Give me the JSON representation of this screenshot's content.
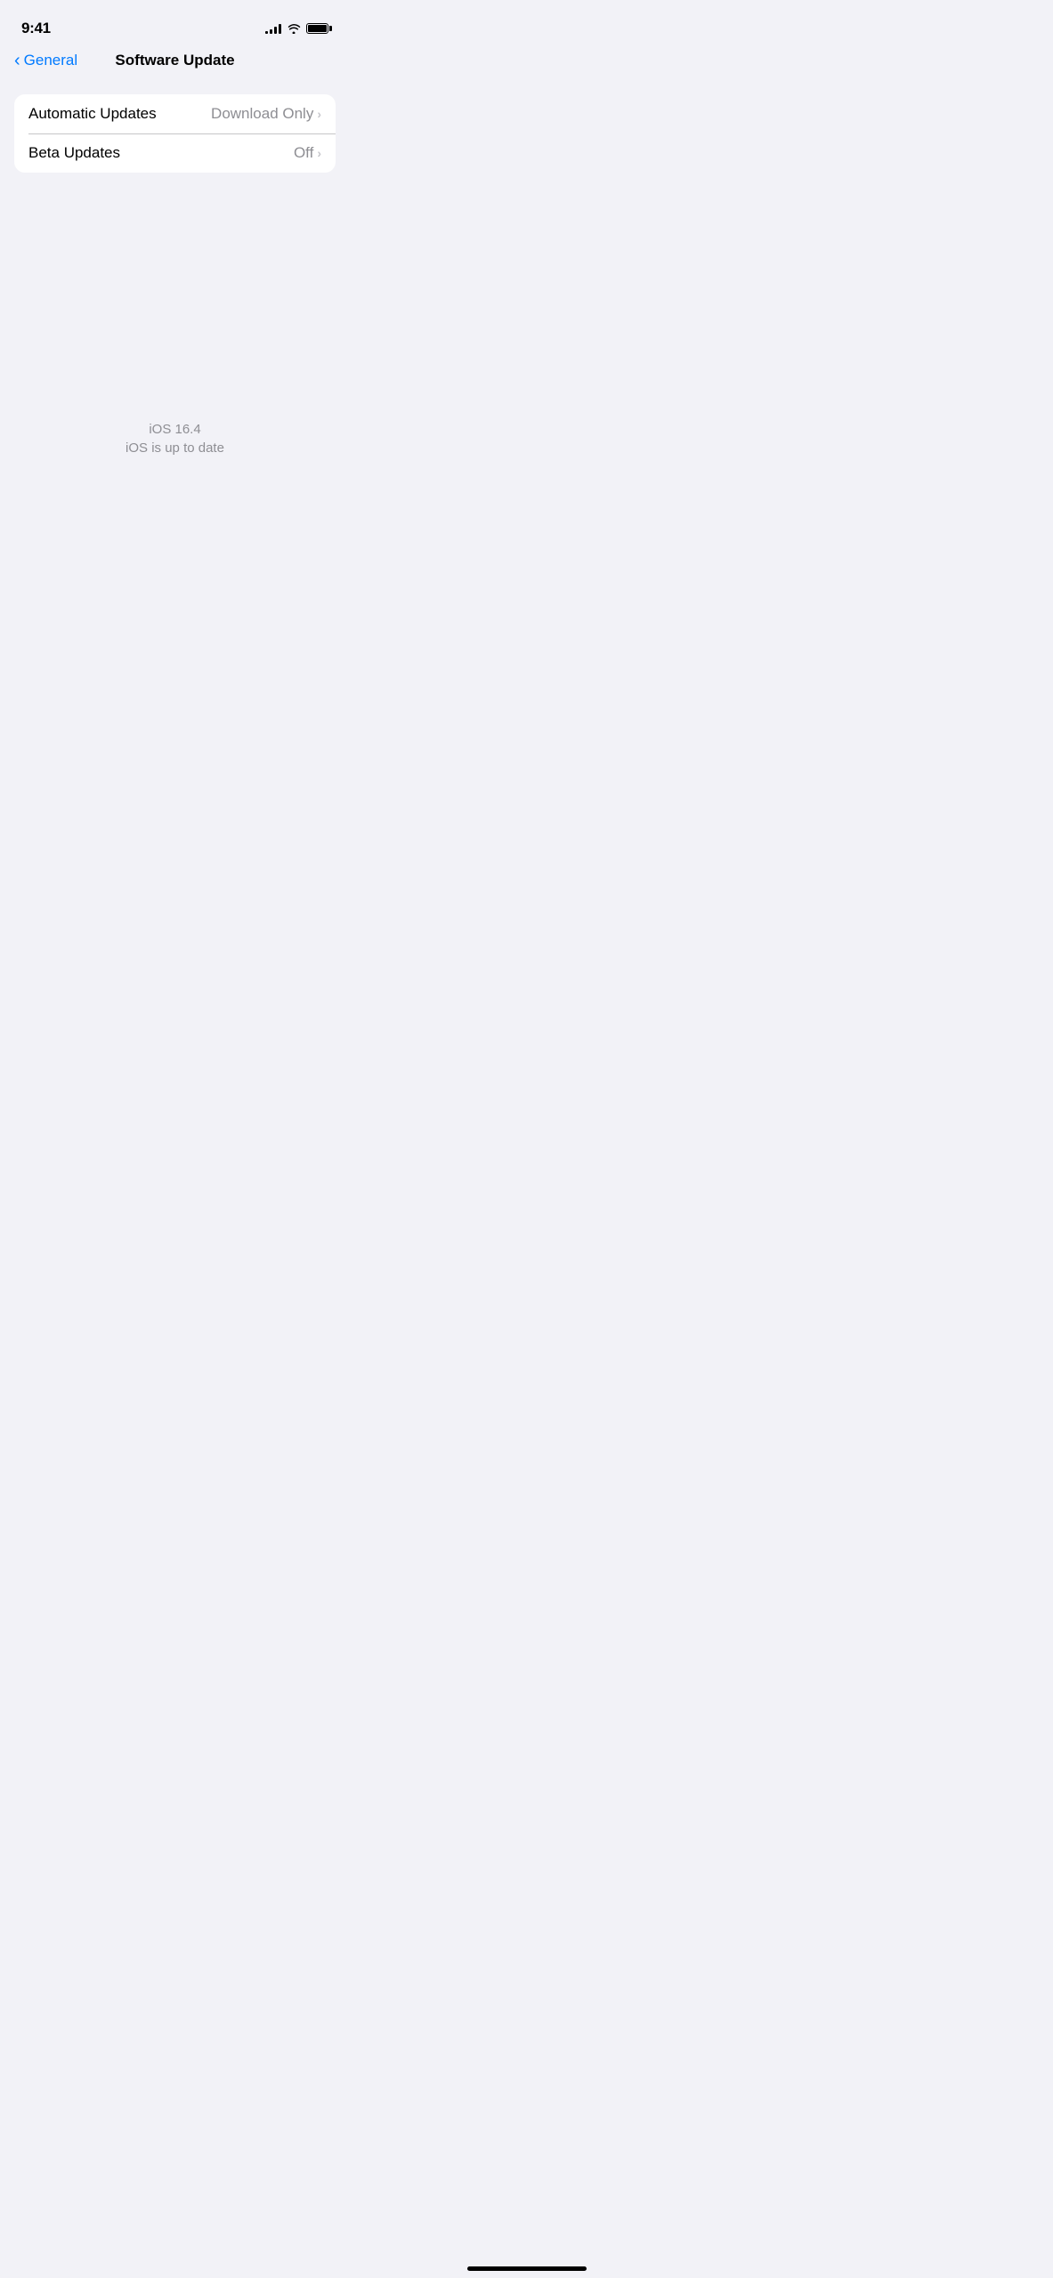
{
  "statusBar": {
    "time": "9:41",
    "signalBars": [
      3,
      5,
      7,
      9,
      11
    ],
    "batteryFull": true
  },
  "navigation": {
    "backLabel": "General",
    "title": "Software Update"
  },
  "settingsRows": [
    {
      "id": "automatic-updates",
      "label": "Automatic Updates",
      "value": "Download Only",
      "hasChevron": true
    },
    {
      "id": "beta-updates",
      "label": "Beta Updates",
      "value": "Off",
      "hasChevron": true
    }
  ],
  "versionInfo": {
    "version": "iOS 16.4",
    "status": "iOS is up to date"
  },
  "icons": {
    "backChevron": "‹",
    "rowChevron": "›"
  }
}
